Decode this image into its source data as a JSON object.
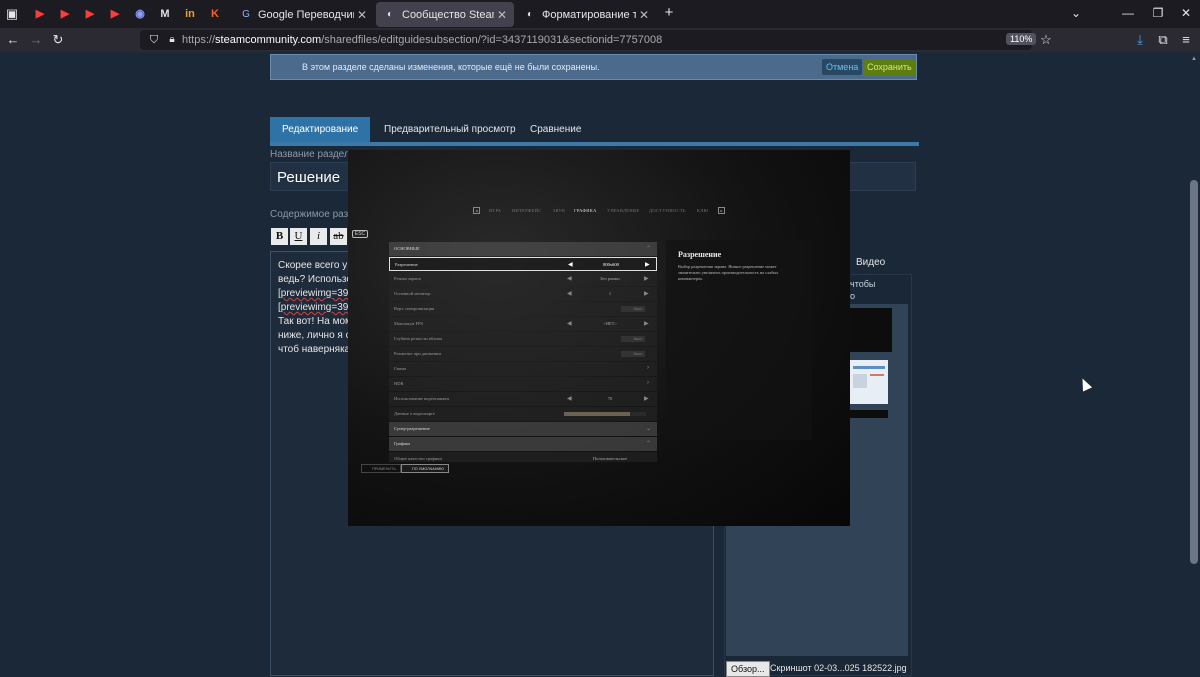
{
  "browser": {
    "tabs": [
      {
        "label": "Google Переводчик",
        "icon": "google-translate-icon"
      },
      {
        "label": "Сообщество Steam :: Редактир",
        "icon": "steam-icon",
        "active": true
      },
      {
        "label": "Форматирование текста",
        "icon": "steam-icon"
      }
    ],
    "pinned_icons": [
      "youtube-icon",
      "youtube-icon",
      "youtube-icon",
      "youtube-icon",
      "discord-icon",
      "gmail-icon",
      "linkedin-icon",
      "app-icon"
    ],
    "url_prefix": "https://",
    "url_host": "steamcommunity.com",
    "url_path": "/sharedfiles/editguidesubsection/?id=3437119031&sectionid=7757008",
    "zoom": "110%",
    "new_tab": "+"
  },
  "notice": {
    "text": "В этом разделе сделаны изменения, которые ещё не были сохранены.",
    "cancel": "Отмена",
    "save": "Сохранить"
  },
  "editor_tabs": [
    "Редактирование",
    "Предварительный просмотр",
    "Сравнение"
  ],
  "section_name_label": "Название раздела",
  "section_title": "Решение",
  "content_label": "Содержимое разд",
  "toolbar": [
    "B",
    "U",
    "i",
    "ab"
  ],
  "editor_lines": [
    "Скорее всего у в",
    "ведь? Использо",
    "[previewimg=398",
    "[previewimg=398",
    "Так вот! На мом",
    "ниже, лично я с",
    "чтоб наверняка,"
  ],
  "side_panel": {
    "tab": "Видео",
    "line1": "чтобы",
    "line2": "о",
    "browse": "Обзор...",
    "file": "Скриншот 02-03...025 182522.jpg"
  },
  "lightbox": {
    "close": "ESC",
    "nav": [
      "ИГРА",
      "ИНТЕРФЕЙС",
      "ЗВУК",
      "ГРАФИКА",
      "УПРАВЛЕНИЕ",
      "ДОСТУПНОСТЬ",
      "КЛЮ"
    ],
    "nav_active": 3,
    "rows": [
      {
        "label": "ОСНОВНЫЕ",
        "kind": "head"
      },
      {
        "label": "Разрешение",
        "value": "800x600",
        "kind": "select",
        "selected": true
      },
      {
        "label": "Режим экрана",
        "value": "Без рамки",
        "kind": "select"
      },
      {
        "label": "Основной монитор",
        "value": "1",
        "kind": "select"
      },
      {
        "label": "Верт. синхронизация",
        "value": "Выкл.",
        "kind": "toggle"
      },
      {
        "label": "Максимум FPS",
        "value": "<НЕТ>",
        "kind": "select"
      },
      {
        "label": "Глубина резкости вблизи",
        "value": "Выкл.",
        "kind": "toggle"
      },
      {
        "label": "Размытие при движении",
        "value": "Выкл.",
        "kind": "toggle"
      },
      {
        "label": "Гамма",
        "kind": "link"
      },
      {
        "label": "HDR",
        "kind": "link"
      },
      {
        "label": "Использование видеопамяти",
        "value": "70",
        "kind": "select"
      },
      {
        "label": "Данные о видеокарте",
        "value": 0.8,
        "kind": "slider"
      },
      {
        "label": "Супер-разрешение",
        "kind": "collapsed"
      },
      {
        "label": "Графика",
        "kind": "head"
      },
      {
        "label": "Общее качество графики",
        "value": "Пользовательское",
        "kind": "select"
      }
    ],
    "desc_title": "Разрешение",
    "desc_text": "Выбор разрешения экрана. Низкое разрешение может значительно увеличить производительность на слабых компьютерах.",
    "footer": [
      "ПРИМЕНИТЬ",
      "ПО УМОЛЧАНИЮ"
    ]
  }
}
